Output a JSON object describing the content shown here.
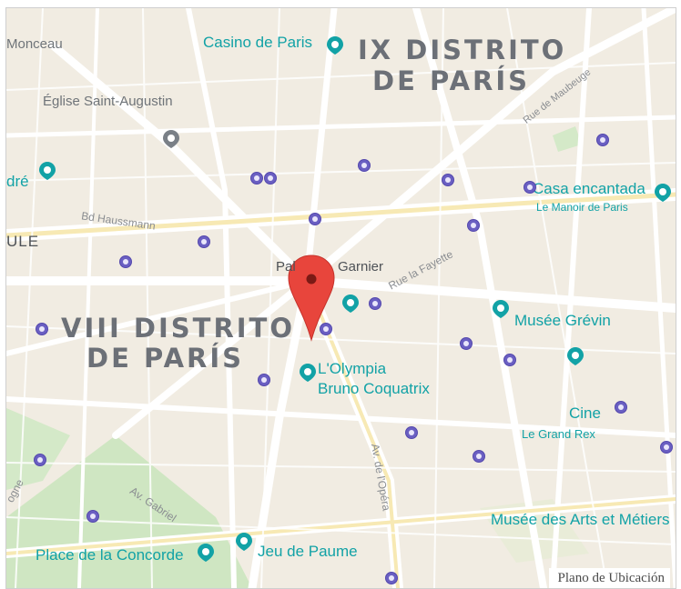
{
  "districts": {
    "ix_line1": "IX DISTRITO",
    "ix_line2": "DE PARÍS",
    "viii_line1": "VIII DISTRITO",
    "viii_line2": "DE PARÍS"
  },
  "labels": {
    "monceau": "Monceau",
    "casino": "Casino de Paris",
    "augustin": "Église Saint-Augustin",
    "dre": "dré",
    "bd_haussmann": "Bd Haussmann",
    "ule": "ULE",
    "palais_garnier_a": "Pal",
    "palais_garnier_b": "Garnier",
    "rue_la_fayette": "Rue la Fayette",
    "rue_maubeuge": "Rue de Maubeuge",
    "casa_encantada": "Casa encantada",
    "manoir": "Le Manoir de Paris",
    "musee_grevin": "Musée Grévin",
    "olympia": "L'Olympia",
    "bruno": "Bruno Coquatrix",
    "cine": "Cine",
    "grand_rex": "Le Grand Rex",
    "av_opera": "Av. de l'Opéra",
    "av_gabriel": "Av. Gabriel",
    "concorde": "Place de la Concorde",
    "jeu_paume": "Jeu de Paume",
    "arts_metiers": "Musée des Arts et Métiers",
    "royale": "ogne"
  },
  "caption": "Plano de Ubicación",
  "colors": {
    "teal_poi": "#12a2a6",
    "metro": "#6a5fc2",
    "marker": "#e8453c",
    "park": "#cde8c3",
    "road": "#ffffff",
    "background": "#f3efe6"
  },
  "icons": {
    "marker": "map-pin-icon",
    "metro": "metro-station-icon",
    "poi": "place-pin-icon"
  }
}
